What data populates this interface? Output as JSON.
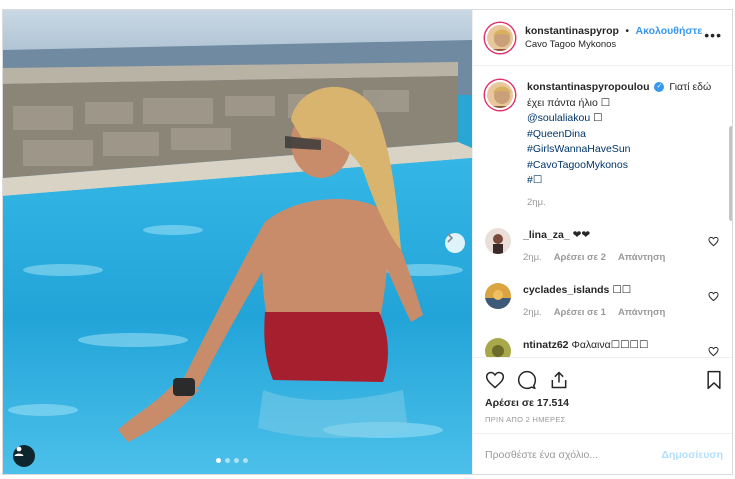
{
  "post": {
    "username": "konstantinaspyropoulou",
    "header_username": "konstantinaspyrop",
    "follow_label": "Ακολουθήστε",
    "separator": "•",
    "location": "Cavo Tagoo Mykonos",
    "more_label": "•••",
    "verified_mark": "✓"
  },
  "caption": {
    "username": "konstantinaspyropoulou",
    "line1": "Γιατί εδώ έχει πάντα ήλιο ☐",
    "mention": "@soulaliakou",
    "mention_suffix": " ☐",
    "hashtags": [
      "#QueenDina",
      "#GirlsWannaHaveSun",
      "#CavoTagooMykonos",
      "#☐"
    ],
    "time": "2ημ."
  },
  "comments": [
    {
      "username": "_lina_za_",
      "text": "❤❤",
      "time": "2ημ.",
      "likes_label": "Αρέσει σε 2",
      "reply_label": "Απάντηση"
    },
    {
      "username": "cyclades_islands",
      "text": "☐☐",
      "time": "2ημ.",
      "likes_label": "Αρέσει σε 1",
      "reply_label": "Απάντηση"
    },
    {
      "username": "ntinatz62",
      "text": "Φαλαινα☐☐☐☐"
    }
  ],
  "stats": {
    "likes": "Αρέσει σε 17.514",
    "posted_ago": "ΠΡΙΝ ΑΠΟ 2 ΗΜΕΡΕΣ"
  },
  "add_comment": {
    "placeholder": "Προσθέστε ένα σχόλιο...",
    "post_label": "Δημοσίευση"
  },
  "icons": {
    "like": "heart-icon",
    "comment": "comment-icon",
    "share": "share-icon",
    "save": "bookmark-icon",
    "next": "chevron-right-icon",
    "tags": "user-tag-icon"
  },
  "colors": {
    "link_blue": "#3897f0",
    "hashtag": "#003569",
    "muted": "#999999",
    "pool": "#2aa6d4"
  },
  "carousel": {
    "count": 4,
    "active": 1
  }
}
